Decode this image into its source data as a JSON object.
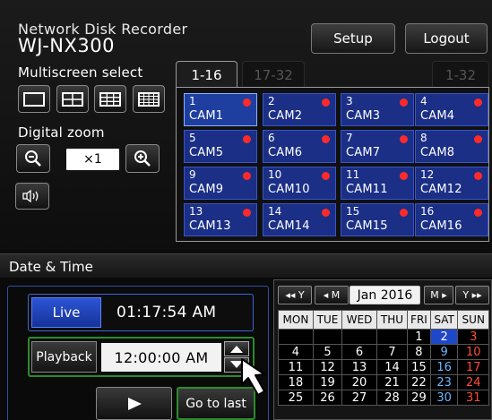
{
  "header": {
    "brand_line1": "Network Disk Recorder",
    "brand_line2": "WJ-NX300",
    "setup_label": "Setup",
    "logout_label": "Logout"
  },
  "multiscreen": {
    "label": "Multiscreen select",
    "layouts": [
      "1-screen",
      "4-screen",
      "9-screen",
      "16-screen"
    ]
  },
  "zoom": {
    "label": "Digital zoom",
    "value": "×1",
    "zoom_out_icon": "zoom-out-icon",
    "zoom_in_icon": "zoom-in-icon",
    "audio_icon": "audio-icon"
  },
  "tabs": [
    {
      "label": "1-16",
      "active": true
    },
    {
      "label": "17-32",
      "active": false
    },
    {
      "label": "1-32",
      "active": false
    }
  ],
  "cameras": [
    {
      "num": "1",
      "name": "CAM1",
      "selected": true
    },
    {
      "num": "2",
      "name": "CAM2"
    },
    {
      "num": "3",
      "name": "CAM3"
    },
    {
      "num": "4",
      "name": "CAM4"
    },
    {
      "num": "5",
      "name": "CAM5"
    },
    {
      "num": "6",
      "name": "CAM6"
    },
    {
      "num": "7",
      "name": "CAM7"
    },
    {
      "num": "8",
      "name": "CAM8"
    },
    {
      "num": "9",
      "name": "CAM9"
    },
    {
      "num": "10",
      "name": "CAM10"
    },
    {
      "num": "11",
      "name": "CAM11"
    },
    {
      "num": "12",
      "name": "CAM12"
    },
    {
      "num": "13",
      "name": "CAM13"
    },
    {
      "num": "14",
      "name": "CAM14"
    },
    {
      "num": "15",
      "name": "CAM15"
    },
    {
      "num": "16",
      "name": "CAM16"
    }
  ],
  "colors": {
    "cam_tile": "#1b2f86",
    "rec_dot": "#ff2a2a",
    "live_accent": "#2c55d4",
    "playback_border": "#2e8a2e",
    "today": "#1f48c9"
  },
  "datetime": {
    "section_label": "Date & Time",
    "live_label": "Live",
    "live_time": "01:17:54 AM",
    "playback_label": "Playback",
    "playback_time": "12:00:00 AM",
    "play_icon": "play-icon",
    "go_to_last_label": "Go to last"
  },
  "calendar": {
    "prev_year": "◂◂ Y",
    "prev_month": "◂ M",
    "month": "Jan 2016",
    "next_month": "M ▸",
    "next_year": "Y ▸▸",
    "days": [
      "MON",
      "TUE",
      "WED",
      "THU",
      "FRI",
      "SAT",
      "SUN"
    ],
    "weeks": [
      [
        "",
        "",
        "",
        "",
        "1",
        "2",
        "3"
      ],
      [
        "4",
        "5",
        "6",
        "7",
        "8",
        "9",
        "10"
      ],
      [
        "11",
        "12",
        "13",
        "14",
        "15",
        "16",
        "17"
      ],
      [
        "18",
        "19",
        "20",
        "21",
        "22",
        "23",
        "24"
      ],
      [
        "25",
        "26",
        "27",
        "28",
        "29",
        "30",
        "31"
      ]
    ],
    "today": "2"
  }
}
